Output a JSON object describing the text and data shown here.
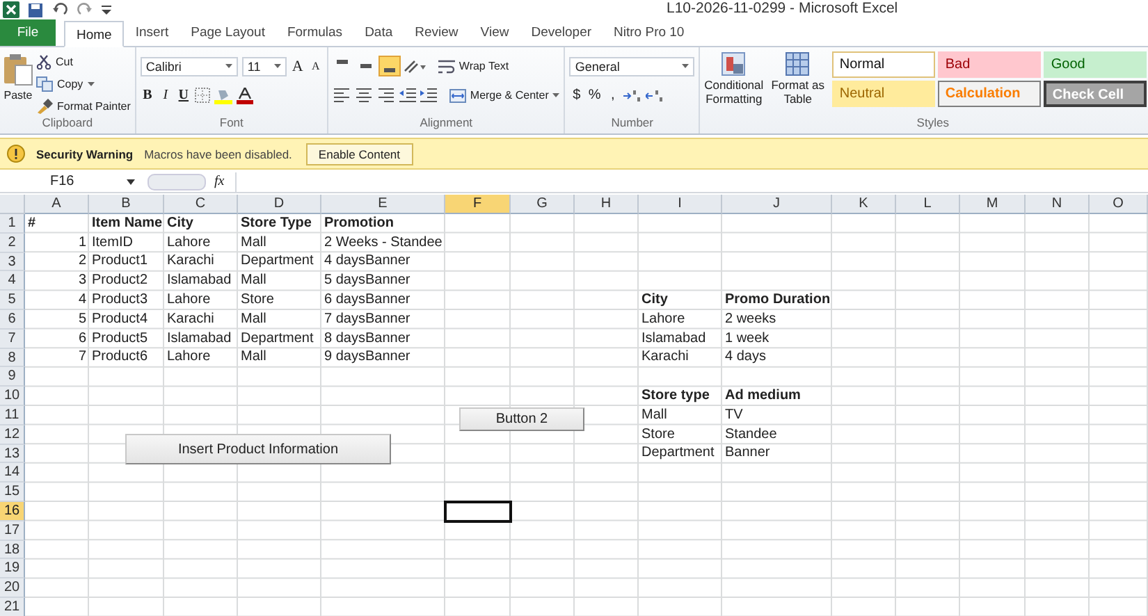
{
  "window": {
    "title": "L10-2026-11-0299  -  Microsoft Excel"
  },
  "tabs": [
    {
      "label": "File",
      "kind": "file",
      "selected": false
    },
    {
      "label": "Home",
      "kind": "tab",
      "selected": true
    },
    {
      "label": "Insert",
      "kind": "tab",
      "selected": false
    },
    {
      "label": "Page Layout",
      "kind": "tab",
      "selected": false
    },
    {
      "label": "Formulas",
      "kind": "tab",
      "selected": false
    },
    {
      "label": "Data",
      "kind": "tab",
      "selected": false
    },
    {
      "label": "Review",
      "kind": "tab",
      "selected": false
    },
    {
      "label": "View",
      "kind": "tab",
      "selected": false
    },
    {
      "label": "Developer",
      "kind": "tab",
      "selected": false
    },
    {
      "label": "Nitro Pro 10",
      "kind": "tab",
      "selected": false
    }
  ],
  "ribbon": {
    "clipboard": {
      "label": "Clipboard",
      "paste": "Paste",
      "cut": "Cut",
      "copy": "Copy",
      "format_painter": "Format Painter"
    },
    "font": {
      "label": "Font",
      "family": "Calibri",
      "size": "11",
      "grow": "A",
      "shrink": "A",
      "bold": "B",
      "italic": "I",
      "underline": "U"
    },
    "alignment": {
      "label": "Alignment",
      "vertical": [
        {
          "selected": false
        },
        {
          "selected": false
        },
        {
          "selected": true
        }
      ],
      "wrap_text": "Wrap Text",
      "merge": "Merge & Center"
    },
    "number": {
      "label": "Number",
      "format": "General",
      "currency": "$",
      "percent": "%",
      "comma": ","
    },
    "styles": {
      "label": "Styles",
      "conditional": "Conditional Formatting",
      "format_table": "Format as Table",
      "cells": [
        {
          "label": "Normal",
          "kind": "normal"
        },
        {
          "label": "Bad",
          "kind": "bad"
        },
        {
          "label": "Good",
          "kind": "good"
        },
        {
          "label": "Neutral",
          "kind": "neutral"
        },
        {
          "label": "Calculation",
          "kind": "calculation"
        },
        {
          "label": "Check Cell",
          "kind": "check"
        }
      ]
    }
  },
  "message_bar": {
    "title": "Security Warning",
    "text": "Macros have been disabled.",
    "button": "Enable Content"
  },
  "formula_bar": {
    "name_box": "F16",
    "function_label": "fx"
  },
  "sheet": {
    "columns": [
      {
        "label": "A",
        "selected": false
      },
      {
        "label": "B",
        "selected": false
      },
      {
        "label": "C",
        "selected": false
      },
      {
        "label": "D",
        "selected": false
      },
      {
        "label": "E",
        "selected": false
      },
      {
        "label": "F",
        "selected": true
      },
      {
        "label": "G",
        "selected": false
      },
      {
        "label": "H",
        "selected": false
      },
      {
        "label": "I",
        "selected": false
      },
      {
        "label": "J",
        "selected": false
      },
      {
        "label": "K",
        "selected": false
      },
      {
        "label": "L",
        "selected": false
      },
      {
        "label": "M",
        "selected": false
      },
      {
        "label": "N",
        "selected": false
      },
      {
        "label": "O",
        "selected": false
      }
    ],
    "rows": [
      {
        "label": "1",
        "selected": false,
        "cells": [
          {
            "text": "#",
            "bold": true
          },
          {
            "text": "Item Name",
            "bold": true
          },
          {
            "text": "City",
            "bold": true
          },
          {
            "text": "Store Type",
            "bold": true
          },
          {
            "text": "Promotion",
            "bold": true
          },
          null,
          null,
          null,
          null,
          null,
          null,
          null,
          null,
          null,
          null
        ]
      },
      {
        "label": "2",
        "selected": false,
        "cells": [
          {
            "text": "1",
            "kind": "number"
          },
          {
            "text": "ItemID"
          },
          {
            "text": "Lahore"
          },
          {
            "text": "Mall"
          },
          {
            "text": "2 Weeks - Standee"
          },
          null,
          null,
          null,
          null,
          null,
          null,
          null,
          null,
          null,
          null
        ]
      },
      {
        "label": "3",
        "selected": false,
        "cells": [
          {
            "text": "2",
            "kind": "number"
          },
          {
            "text": "Product1"
          },
          {
            "text": "Karachi"
          },
          {
            "text": "Department"
          },
          {
            "text": "4 daysBanner"
          },
          null,
          null,
          null,
          null,
          null,
          null,
          null,
          null,
          null,
          null
        ]
      },
      {
        "label": "4",
        "selected": false,
        "cells": [
          {
            "text": "3",
            "kind": "number"
          },
          {
            "text": "Product2"
          },
          {
            "text": "Islamabad"
          },
          {
            "text": "Mall"
          },
          {
            "text": "5 daysBanner"
          },
          null,
          null,
          null,
          null,
          null,
          null,
          null,
          null,
          null,
          null
        ]
      },
      {
        "label": "5",
        "selected": false,
        "cells": [
          {
            "text": "4",
            "kind": "number"
          },
          {
            "text": "Product3"
          },
          {
            "text": "Lahore"
          },
          {
            "text": "Store"
          },
          {
            "text": "6 daysBanner"
          },
          null,
          null,
          null,
          {
            "text": "City",
            "bold": true
          },
          {
            "text": "Promo Duration",
            "bold": true
          },
          null,
          null,
          null,
          null,
          null
        ]
      },
      {
        "label": "6",
        "selected": false,
        "cells": [
          {
            "text": "5",
            "kind": "number"
          },
          {
            "text": "Product4"
          },
          {
            "text": "Karachi"
          },
          {
            "text": "Mall"
          },
          {
            "text": "7 daysBanner"
          },
          null,
          null,
          null,
          {
            "text": "Lahore"
          },
          {
            "text": "2 weeks"
          },
          null,
          null,
          null,
          null,
          null
        ]
      },
      {
        "label": "7",
        "selected": false,
        "cells": [
          {
            "text": "6",
            "kind": "number"
          },
          {
            "text": "Product5"
          },
          {
            "text": "Islamabad"
          },
          {
            "text": "Department"
          },
          {
            "text": "8 daysBanner"
          },
          null,
          null,
          null,
          {
            "text": "Islamabad"
          },
          {
            "text": "1 week"
          },
          null,
          null,
          null,
          null,
          null
        ]
      },
      {
        "label": "8",
        "selected": false,
        "cells": [
          {
            "text": "7",
            "kind": "number"
          },
          {
            "text": "Product6"
          },
          {
            "text": "Lahore"
          },
          {
            "text": "Mall"
          },
          {
            "text": "9 daysBanner"
          },
          null,
          null,
          null,
          {
            "text": "Karachi"
          },
          {
            "text": "4 days"
          },
          null,
          null,
          null,
          null,
          null
        ]
      },
      {
        "label": "9",
        "selected": false,
        "cells": [
          null,
          null,
          null,
          null,
          null,
          null,
          null,
          null,
          null,
          null,
          null,
          null,
          null,
          null,
          null
        ]
      },
      {
        "label": "10",
        "selected": false,
        "cells": [
          null,
          null,
          null,
          null,
          null,
          null,
          null,
          null,
          {
            "text": "Store type",
            "bold": true
          },
          {
            "text": "Ad medium",
            "bold": true
          },
          null,
          null,
          null,
          null,
          null
        ]
      },
      {
        "label": "11",
        "selected": false,
        "cells": [
          null,
          null,
          null,
          null,
          null,
          null,
          null,
          null,
          {
            "text": "Mall"
          },
          {
            "text": "TV"
          },
          null,
          null,
          null,
          null,
          null
        ]
      },
      {
        "label": "12",
        "selected": false,
        "cells": [
          null,
          null,
          null,
          null,
          null,
          null,
          null,
          null,
          {
            "text": "Store"
          },
          {
            "text": "Standee"
          },
          null,
          null,
          null,
          null,
          null
        ]
      },
      {
        "label": "13",
        "selected": false,
        "cells": [
          null,
          null,
          null,
          null,
          null,
          null,
          null,
          null,
          {
            "text": "Department"
          },
          {
            "text": "Banner"
          },
          null,
          null,
          null,
          null,
          null
        ]
      },
      {
        "label": "14",
        "selected": false,
        "cells": [
          null,
          null,
          null,
          null,
          null,
          null,
          null,
          null,
          null,
          null,
          null,
          null,
          null,
          null,
          null
        ]
      },
      {
        "label": "15",
        "selected": false,
        "cells": [
          null,
          null,
          null,
          null,
          null,
          null,
          null,
          null,
          null,
          null,
          null,
          null,
          null,
          null,
          null
        ]
      },
      {
        "label": "16",
        "selected": true,
        "cells": [
          null,
          null,
          null,
          null,
          null,
          null,
          null,
          null,
          null,
          null,
          null,
          null,
          null,
          null,
          null
        ]
      },
      {
        "label": "17",
        "selected": false,
        "cells": [
          null,
          null,
          null,
          null,
          null,
          null,
          null,
          null,
          null,
          null,
          null,
          null,
          null,
          null,
          null
        ]
      },
      {
        "label": "18",
        "selected": false,
        "cells": [
          null,
          null,
          null,
          null,
          null,
          null,
          null,
          null,
          null,
          null,
          null,
          null,
          null,
          null,
          null
        ]
      },
      {
        "label": "19",
        "selected": false,
        "cells": [
          null,
          null,
          null,
          null,
          null,
          null,
          null,
          null,
          null,
          null,
          null,
          null,
          null,
          null,
          null
        ]
      },
      {
        "label": "20",
        "selected": false,
        "cells": [
          null,
          null,
          null,
          null,
          null,
          null,
          null,
          null,
          null,
          null,
          null,
          null,
          null,
          null,
          null
        ]
      },
      {
        "label": "21",
        "selected": false,
        "cells": [
          null,
          null,
          null,
          null,
          null,
          null,
          null,
          null,
          null,
          null,
          null,
          null,
          null,
          null,
          null
        ]
      }
    ],
    "controls": [
      {
        "label": "Insert Product Information"
      },
      {
        "label": "Button 2"
      }
    ]
  }
}
